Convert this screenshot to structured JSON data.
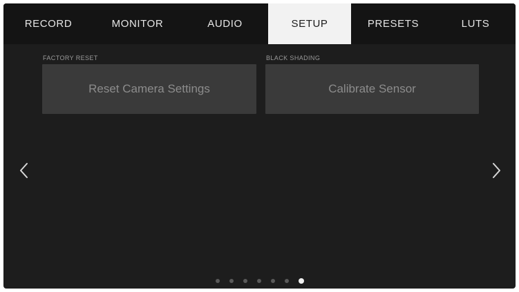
{
  "tabs": [
    {
      "label": "RECORD",
      "active": false
    },
    {
      "label": "MONITOR",
      "active": false
    },
    {
      "label": "AUDIO",
      "active": false
    },
    {
      "label": "SETUP",
      "active": true
    },
    {
      "label": "PRESETS",
      "active": false
    },
    {
      "label": "LUTS",
      "active": false
    }
  ],
  "factory_reset": {
    "label": "FACTORY RESET",
    "button": "Reset Camera Settings"
  },
  "black_shading": {
    "label": "BLACK SHADING",
    "button": "Calibrate Sensor"
  },
  "navigation": {
    "prev_icon": "chevron-left-icon",
    "next_icon": "chevron-right-icon"
  },
  "pager": {
    "total_pages": 7,
    "current_page": 7
  },
  "colors": {
    "active_tab_bg": "#f2f2f2",
    "button_bg": "#3a3a3a",
    "screen_bg": "#1d1d1d"
  }
}
